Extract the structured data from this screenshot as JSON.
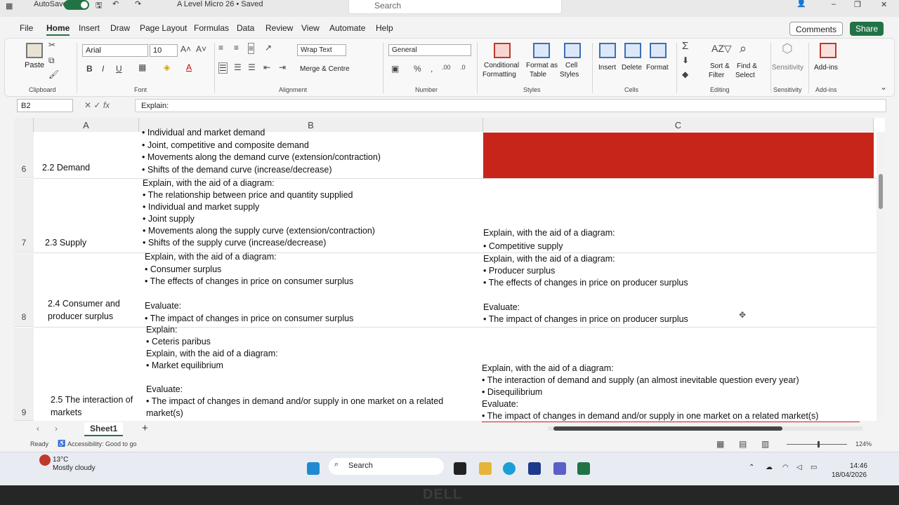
{
  "titlebar": {
    "autosave": "AutoSave",
    "filename": "A Level Micro 26 • Saved",
    "search_placeholder": "Search"
  },
  "menu": {
    "tabs": [
      "File",
      "Home",
      "Insert",
      "Draw",
      "Page Layout",
      "Formulas",
      "Data",
      "Review",
      "View",
      "Automate",
      "Help"
    ],
    "active": "Home",
    "comments": "Comments",
    "share": "Share"
  },
  "ribbon": {
    "clipboard": {
      "paste": "Paste",
      "group": "Clipboard"
    },
    "font": {
      "name": "Arial",
      "size": "10",
      "group": "Font"
    },
    "alignment": {
      "wrap": "Wrap Text",
      "merge": "Merge & Centre",
      "group": "Alignment"
    },
    "number": {
      "format": "General",
      "group": "Number"
    },
    "styles": {
      "conditional": "Conditional",
      "conditional2": "Formatting",
      "format_as": "Format as",
      "format_as2": "Table",
      "cell": "Cell",
      "cell2": "Styles",
      "group": "Styles"
    },
    "cells": {
      "insert": "Insert",
      "delete": "Delete",
      "format": "Format",
      "group": "Cells"
    },
    "editing": {
      "sort": "Sort &",
      "sort2": "Filter",
      "find": "Find &",
      "find2": "Select",
      "group": "Editing"
    },
    "sensitivity": {
      "label": "Sensitivity",
      "group": "Sensitivity"
    },
    "addins": {
      "label": "Add-ins",
      "group": "Add-ins"
    }
  },
  "formula": {
    "namebox": "B2",
    "fx": "fx",
    "content": "Explain:"
  },
  "columns": [
    "A",
    "B",
    "C"
  ],
  "rows": [
    {
      "num": "6",
      "a": "2.2 Demand",
      "b": "• Individual and market demand\n• Joint, competitive and composite demand\n• Movements along the demand curve (extension/contraction)\n• Shifts of the demand curve (increase/decrease)",
      "c": ""
    },
    {
      "num": "7",
      "a": "2.3 Supply",
      "b": "Explain, with the aid of a diagram:\n• The relationship between price and quantity supplied\n• Individual and market supply\n• Joint supply\n• Movements along the supply curve (extension/contraction)\n• Shifts of the supply curve (increase/decrease)",
      "c": "Explain, with the aid of a diagram:\n• Competitive supply"
    },
    {
      "num": "8",
      "a": "2.4 Consumer and\nproducer surplus",
      "b": "Explain, with the aid of a diagram:\n• Consumer surplus\n• The effects of changes in price on consumer surplus\n\nEvaluate:\n• The impact of changes in price on consumer surplus",
      "c": "Explain, with the aid of a diagram:\n• Producer surplus\n• The effects of changes in price on producer surplus\n\nEvaluate:\n• The impact of changes in price on producer surplus"
    },
    {
      "num": "9",
      "a": "2.5 The interaction of\nmarkets",
      "b": "Explain:\n• Ceteris paribus\nExplain, with the aid of a diagram:\n• Market equilibrium\n\nEvaluate:\n• The impact of changes in demand and/or supply in one market on a related\nmarket(s)",
      "c": "Explain, with the aid of a diagram:\n• The interaction of demand and supply (an almost inevitable question every year)\n• Disequilibrium\nEvaluate:\n• The impact of changes in demand and/or supply in one market on a related market(s)"
    }
  ],
  "sheet": {
    "tab": "Sheet1",
    "add": "+"
  },
  "status": {
    "ready": "Ready",
    "accessibility": "Accessibility: Good to go",
    "zoom": "124%"
  },
  "taskbar": {
    "temp": "13°C",
    "weather": "Mostly cloudy",
    "search": "Search",
    "time": "14:46",
    "date": "18/04/2026"
  },
  "brand": "DELL",
  "colors": {
    "excel_green": "#217346",
    "red_cell": "#c8251a"
  }
}
